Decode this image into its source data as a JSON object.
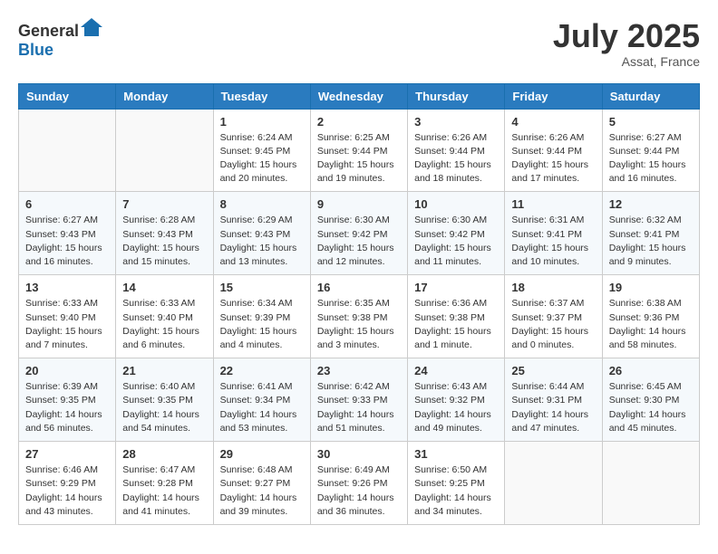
{
  "header": {
    "logo": {
      "general": "General",
      "blue": "Blue"
    },
    "title": "July 2025",
    "location": "Assat, France"
  },
  "weekdays": [
    "Sunday",
    "Monday",
    "Tuesday",
    "Wednesday",
    "Thursday",
    "Friday",
    "Saturday"
  ],
  "weeks": [
    [
      {
        "day": "",
        "info": ""
      },
      {
        "day": "",
        "info": ""
      },
      {
        "day": "1",
        "info": "Sunrise: 6:24 AM\nSunset: 9:45 PM\nDaylight: 15 hours and 20 minutes."
      },
      {
        "day": "2",
        "info": "Sunrise: 6:25 AM\nSunset: 9:44 PM\nDaylight: 15 hours and 19 minutes."
      },
      {
        "day": "3",
        "info": "Sunrise: 6:26 AM\nSunset: 9:44 PM\nDaylight: 15 hours and 18 minutes."
      },
      {
        "day": "4",
        "info": "Sunrise: 6:26 AM\nSunset: 9:44 PM\nDaylight: 15 hours and 17 minutes."
      },
      {
        "day": "5",
        "info": "Sunrise: 6:27 AM\nSunset: 9:44 PM\nDaylight: 15 hours and 16 minutes."
      }
    ],
    [
      {
        "day": "6",
        "info": "Sunrise: 6:27 AM\nSunset: 9:43 PM\nDaylight: 15 hours and 16 minutes."
      },
      {
        "day": "7",
        "info": "Sunrise: 6:28 AM\nSunset: 9:43 PM\nDaylight: 15 hours and 15 minutes."
      },
      {
        "day": "8",
        "info": "Sunrise: 6:29 AM\nSunset: 9:43 PM\nDaylight: 15 hours and 13 minutes."
      },
      {
        "day": "9",
        "info": "Sunrise: 6:30 AM\nSunset: 9:42 PM\nDaylight: 15 hours and 12 minutes."
      },
      {
        "day": "10",
        "info": "Sunrise: 6:30 AM\nSunset: 9:42 PM\nDaylight: 15 hours and 11 minutes."
      },
      {
        "day": "11",
        "info": "Sunrise: 6:31 AM\nSunset: 9:41 PM\nDaylight: 15 hours and 10 minutes."
      },
      {
        "day": "12",
        "info": "Sunrise: 6:32 AM\nSunset: 9:41 PM\nDaylight: 15 hours and 9 minutes."
      }
    ],
    [
      {
        "day": "13",
        "info": "Sunrise: 6:33 AM\nSunset: 9:40 PM\nDaylight: 15 hours and 7 minutes."
      },
      {
        "day": "14",
        "info": "Sunrise: 6:33 AM\nSunset: 9:40 PM\nDaylight: 15 hours and 6 minutes."
      },
      {
        "day": "15",
        "info": "Sunrise: 6:34 AM\nSunset: 9:39 PM\nDaylight: 15 hours and 4 minutes."
      },
      {
        "day": "16",
        "info": "Sunrise: 6:35 AM\nSunset: 9:38 PM\nDaylight: 15 hours and 3 minutes."
      },
      {
        "day": "17",
        "info": "Sunrise: 6:36 AM\nSunset: 9:38 PM\nDaylight: 15 hours and 1 minute."
      },
      {
        "day": "18",
        "info": "Sunrise: 6:37 AM\nSunset: 9:37 PM\nDaylight: 15 hours and 0 minutes."
      },
      {
        "day": "19",
        "info": "Sunrise: 6:38 AM\nSunset: 9:36 PM\nDaylight: 14 hours and 58 minutes."
      }
    ],
    [
      {
        "day": "20",
        "info": "Sunrise: 6:39 AM\nSunset: 9:35 PM\nDaylight: 14 hours and 56 minutes."
      },
      {
        "day": "21",
        "info": "Sunrise: 6:40 AM\nSunset: 9:35 PM\nDaylight: 14 hours and 54 minutes."
      },
      {
        "day": "22",
        "info": "Sunrise: 6:41 AM\nSunset: 9:34 PM\nDaylight: 14 hours and 53 minutes."
      },
      {
        "day": "23",
        "info": "Sunrise: 6:42 AM\nSunset: 9:33 PM\nDaylight: 14 hours and 51 minutes."
      },
      {
        "day": "24",
        "info": "Sunrise: 6:43 AM\nSunset: 9:32 PM\nDaylight: 14 hours and 49 minutes."
      },
      {
        "day": "25",
        "info": "Sunrise: 6:44 AM\nSunset: 9:31 PM\nDaylight: 14 hours and 47 minutes."
      },
      {
        "day": "26",
        "info": "Sunrise: 6:45 AM\nSunset: 9:30 PM\nDaylight: 14 hours and 45 minutes."
      }
    ],
    [
      {
        "day": "27",
        "info": "Sunrise: 6:46 AM\nSunset: 9:29 PM\nDaylight: 14 hours and 43 minutes."
      },
      {
        "day": "28",
        "info": "Sunrise: 6:47 AM\nSunset: 9:28 PM\nDaylight: 14 hours and 41 minutes."
      },
      {
        "day": "29",
        "info": "Sunrise: 6:48 AM\nSunset: 9:27 PM\nDaylight: 14 hours and 39 minutes."
      },
      {
        "day": "30",
        "info": "Sunrise: 6:49 AM\nSunset: 9:26 PM\nDaylight: 14 hours and 36 minutes."
      },
      {
        "day": "31",
        "info": "Sunrise: 6:50 AM\nSunset: 9:25 PM\nDaylight: 14 hours and 34 minutes."
      },
      {
        "day": "",
        "info": ""
      },
      {
        "day": "",
        "info": ""
      }
    ]
  ]
}
